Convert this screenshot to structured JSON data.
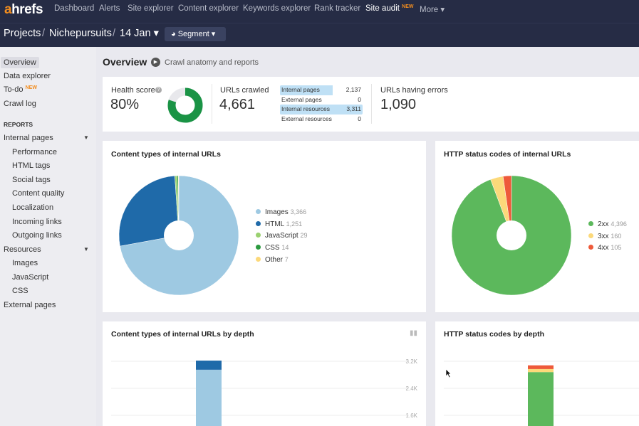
{
  "topnav": {
    "logo": "ahrefs",
    "items": [
      "Dashboard",
      "Alerts",
      "Site explorer",
      "Content explorer",
      "Keywords explorer",
      "Rank tracker",
      "Site audit",
      "More ▾"
    ],
    "new_badge": "NEW"
  },
  "breadcrumb": {
    "projects": "Projects",
    "sep": "/",
    "project": "Nichepursuits",
    "date": "14 Jan ▾",
    "segment": "Segment ▾"
  },
  "sidebar": {
    "items": [
      "Overview",
      "Data explorer",
      "To-do",
      "Crawl log"
    ],
    "todo_badge": "NEW",
    "reports_label": "REPORTS",
    "internal_pages": "Internal pages",
    "internal_sub": [
      "Performance",
      "HTML tags",
      "Social tags",
      "Content quality",
      "Localization",
      "Incoming links",
      "Outgoing links"
    ],
    "resources": "Resources",
    "resources_sub": [
      "Images",
      "JavaScript",
      "CSS"
    ],
    "external_pages": "External pages"
  },
  "header": {
    "title": "Overview",
    "link": "Crawl anatomy and reports"
  },
  "stats": {
    "health_label": "Health score",
    "health_value": "80%",
    "health_fraction": 0.8,
    "crawled_label": "URLs crawled",
    "crawled_value": "4,661",
    "breakdown": [
      {
        "label": "Internal pages",
        "value": "2,137",
        "highlight": true
      },
      {
        "label": "External pages",
        "value": "0",
        "highlight": false
      },
      {
        "label": "Internal resources",
        "value": "3,311",
        "highlight": true
      },
      {
        "label": "External resources",
        "value": "0",
        "highlight": false
      }
    ],
    "errors_label": "URLs having errors",
    "errors_value": "1,090"
  },
  "chart_data": [
    {
      "type": "pie",
      "title": "Content types of internal URLs",
      "labels": [
        "Images",
        "HTML",
        "JavaScript",
        "CSS",
        "Other"
      ],
      "values": [
        3366,
        1251,
        29,
        14,
        7
      ],
      "colors": [
        "#9ec9e2",
        "#1f6aa9",
        "#9ad170",
        "#2b9a3f",
        "#fcd97a"
      ]
    },
    {
      "type": "pie",
      "title": "HTTP status codes of internal URLs",
      "labels": [
        "2xx",
        "3xx",
        "4xx"
      ],
      "values": [
        4396,
        160,
        105
      ],
      "colors": [
        "#5cb85c",
        "#fcd97a",
        "#ee5a3a"
      ]
    },
    {
      "type": "bar",
      "stacked": true,
      "title": "Content types of internal URLs by depth",
      "y_ticks": [
        "3.2K",
        "2.4K",
        "1.6K"
      ],
      "series": [
        {
          "name": "Images",
          "values": [
            2950
          ]
        },
        {
          "name": "HTML",
          "values": [
            270
          ]
        }
      ],
      "colors": [
        "#9ec9e2",
        "#1f6aa9"
      ]
    },
    {
      "type": "bar",
      "stacked": true,
      "title": "HTTP status codes by depth",
      "series": [
        {
          "name": "2xx",
          "values": [
            2880
          ]
        },
        {
          "name": "3xx",
          "values": [
            90
          ]
        },
        {
          "name": "4xx",
          "values": [
            110
          ]
        }
      ],
      "colors": [
        "#5cb85c",
        "#fcd97a",
        "#ee5a3a"
      ]
    }
  ]
}
